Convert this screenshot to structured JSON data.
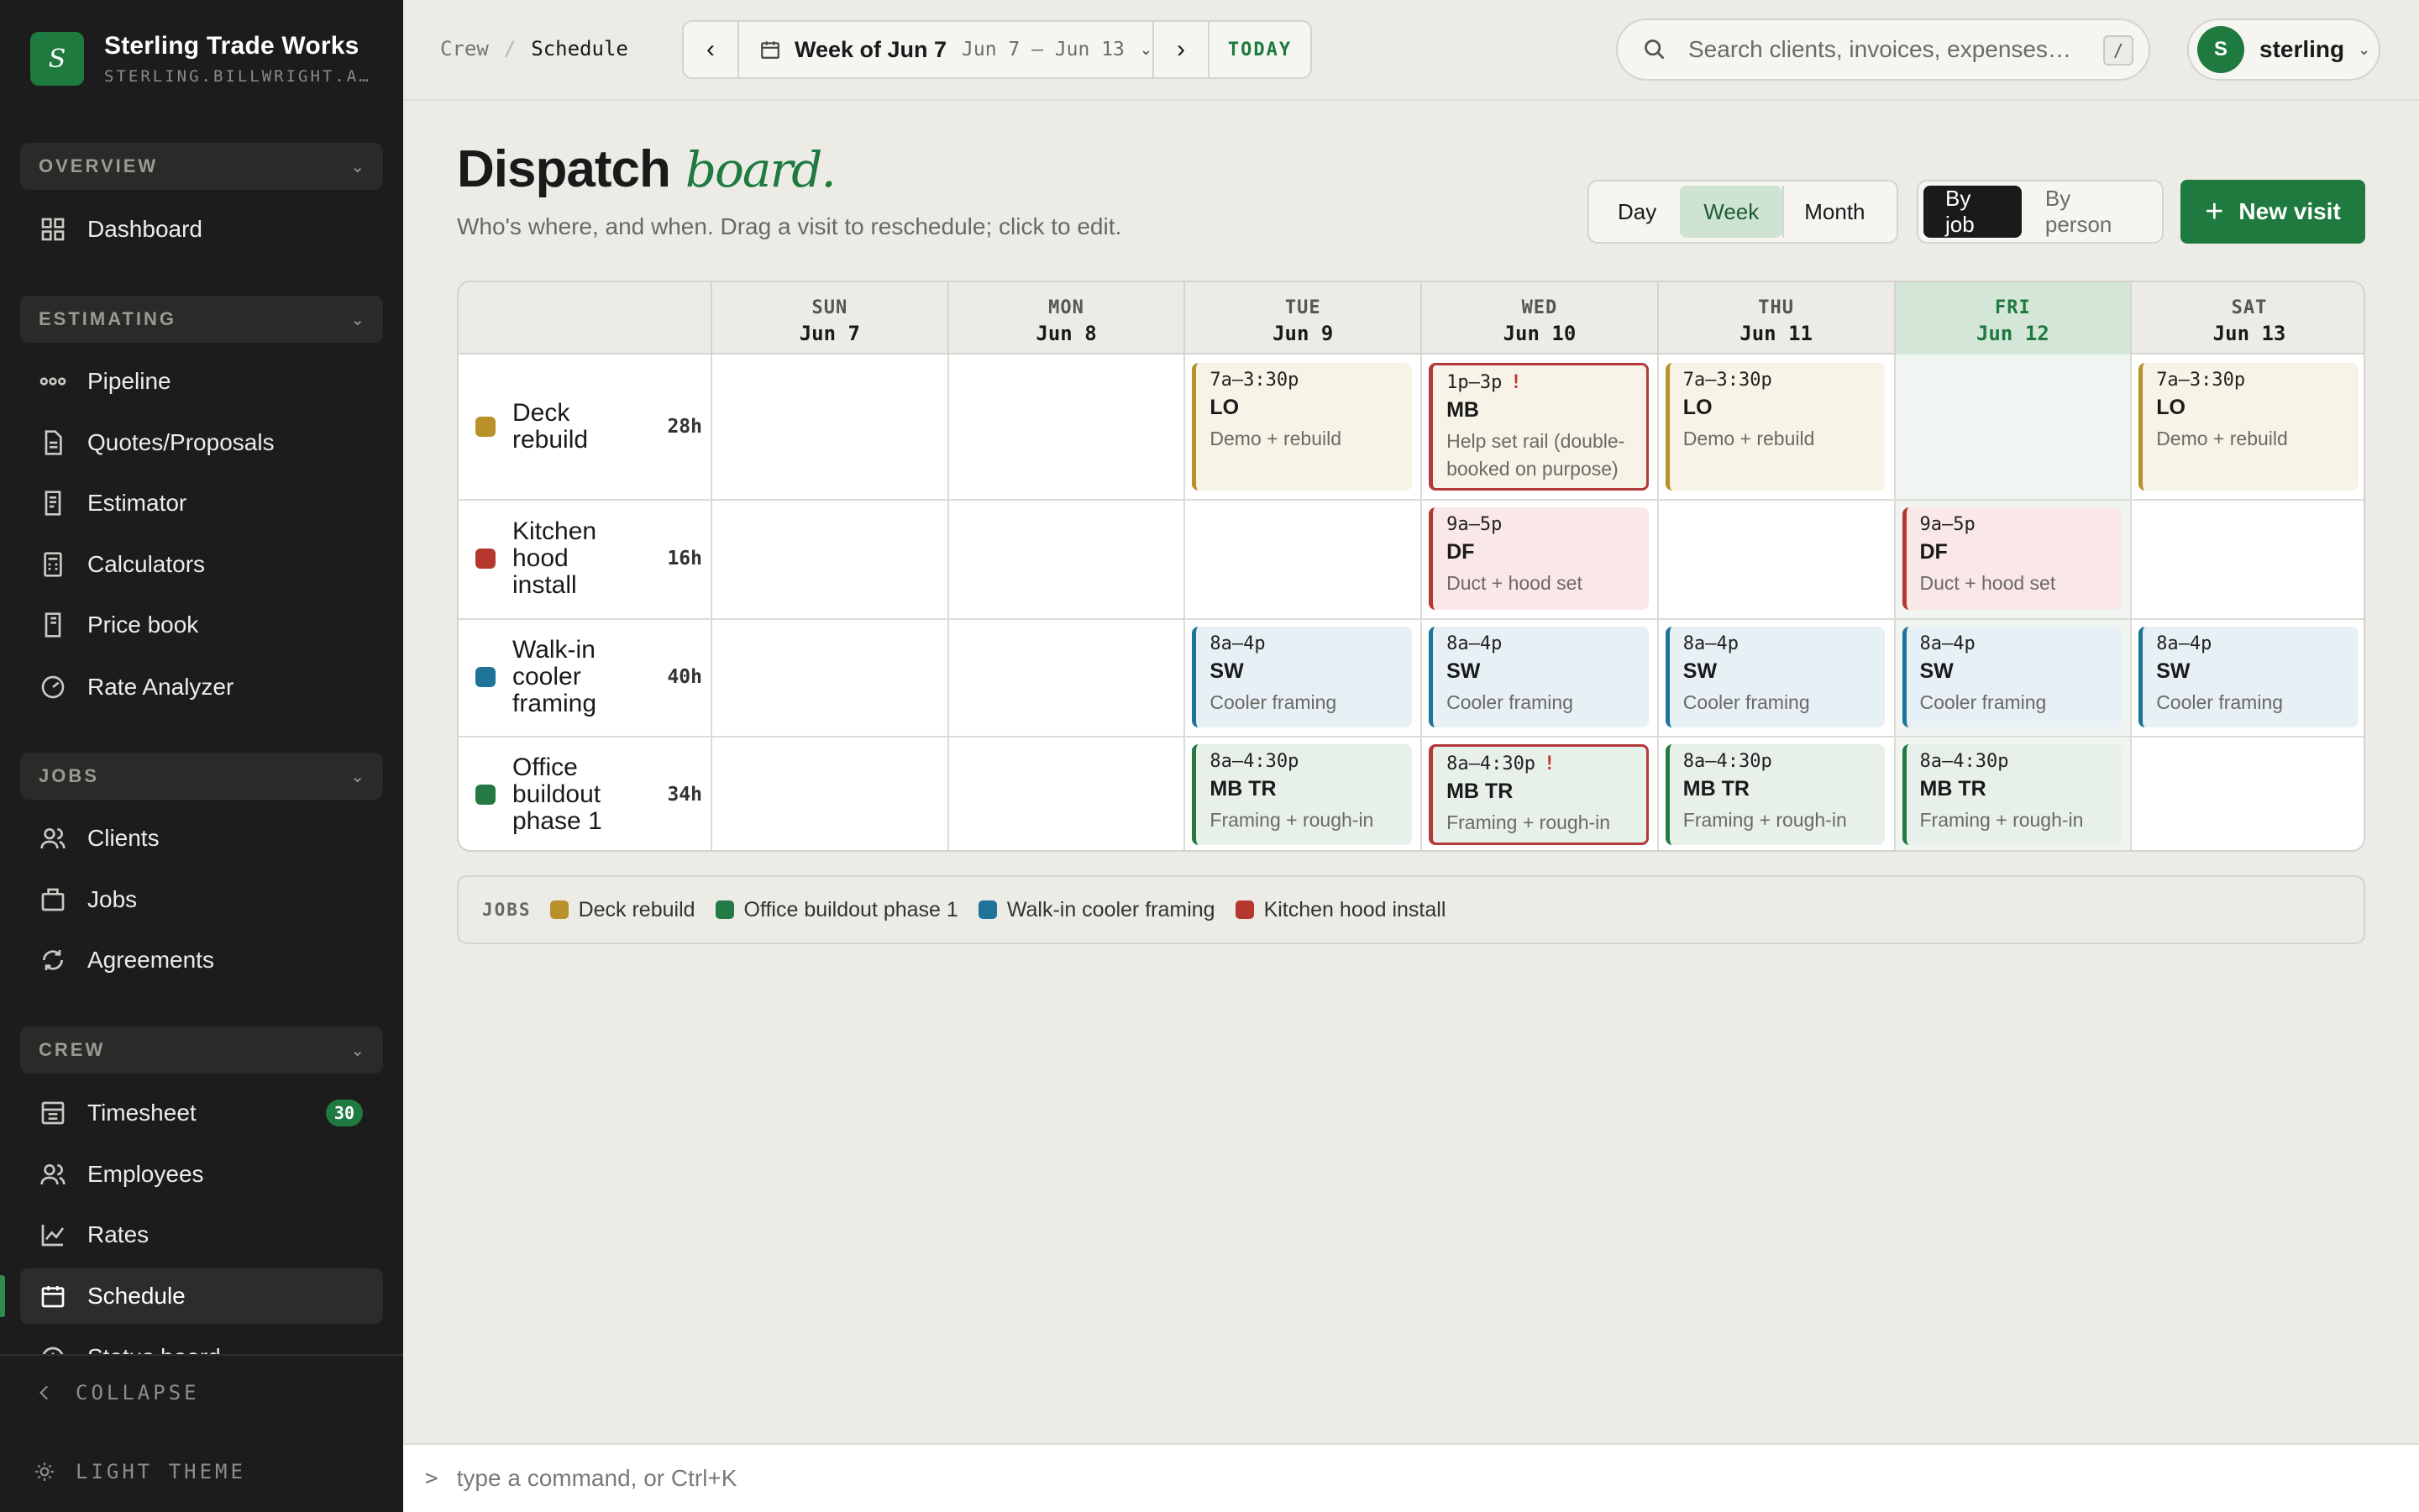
{
  "app": {
    "name": "Sterling Trade Works",
    "subdomain": "STERLING.BILLWRIGHT.A…",
    "logo_letter": "S"
  },
  "sidebar": {
    "groups": {
      "overview": "OVERVIEW",
      "estimating": "ESTIMATING",
      "jobs": "JOBS",
      "crew": "CREW"
    },
    "items": {
      "dashboard": "Dashboard",
      "pipeline": "Pipeline",
      "quotes": "Quotes/Proposals",
      "estimator": "Estimator",
      "calculators": "Calculators",
      "pricebook": "Price book",
      "rate_analyzer": "Rate Analyzer",
      "clients": "Clients",
      "jobs": "Jobs",
      "agreements": "Agreements",
      "timesheet": "Timesheet",
      "timesheet_badge": "30",
      "employees": "Employees",
      "rates": "Rates",
      "schedule": "Schedule",
      "status_board": "Status board"
    },
    "collapse": "COLLAPSE",
    "theme": "LIGHT THEME"
  },
  "topbar": {
    "breadcrumb": [
      "Crew",
      "Schedule"
    ],
    "week_label": "Week of Jun 7",
    "week_range": "Jun 7 – Jun 13",
    "today": "TODAY",
    "search_placeholder": "Search clients, invoices, expenses…",
    "search_kbd": "/",
    "user_initial": "S",
    "user_name": "sterling"
  },
  "page": {
    "title": "Dispatch",
    "title_accent": "board.",
    "subtitle": "Who's where, and when. Drag a visit to reschedule; click to edit.",
    "views": [
      "Day",
      "Week",
      "Month"
    ],
    "active_view": "Week",
    "groupings": [
      "By job",
      "By person"
    ],
    "active_grouping": "By job",
    "new_visit": "New visit"
  },
  "calendar": {
    "days": [
      {
        "dow": "SUN",
        "date": "Jun 7"
      },
      {
        "dow": "MON",
        "date": "Jun 8"
      },
      {
        "dow": "TUE",
        "date": "Jun 9"
      },
      {
        "dow": "WED",
        "date": "Jun 10"
      },
      {
        "dow": "THU",
        "date": "Jun 11"
      },
      {
        "dow": "FRI",
        "date": "Jun 12",
        "today": true
      },
      {
        "dow": "SAT",
        "date": "Jun 13"
      }
    ],
    "jobs": [
      {
        "name": "Deck rebuild",
        "hours": "28h",
        "color": "#b8912a"
      },
      {
        "name": "Kitchen hood install",
        "hours": "16h",
        "color": "#b5382f"
      },
      {
        "name": "Walk-in cooler framing",
        "hours": "40h",
        "color": "#1f7398"
      },
      {
        "name": "Office buildout phase 1",
        "hours": "34h",
        "color": "#247a44"
      }
    ],
    "visits": [
      {
        "job": 0,
        "day": 2,
        "time": "7a–3:30p",
        "crew": "LO",
        "desc": "Demo + rebuild"
      },
      {
        "job": 0,
        "day": 3,
        "time": "1p–3p",
        "crew": "MB",
        "desc": "Help set rail (double-booked on purpose)",
        "flag": "!"
      },
      {
        "job": 0,
        "day": 4,
        "time": "7a–3:30p",
        "crew": "LO",
        "desc": "Demo + rebuild"
      },
      {
        "job": 0,
        "day": 6,
        "time": "7a–3:30p",
        "crew": "LO",
        "desc": "Demo + rebuild"
      },
      {
        "job": 1,
        "day": 3,
        "time": "9a–5p",
        "crew": "DF",
        "desc": "Duct + hood set"
      },
      {
        "job": 1,
        "day": 5,
        "time": "9a–5p",
        "crew": "DF",
        "desc": "Duct + hood set"
      },
      {
        "job": 2,
        "day": 2,
        "time": "8a–4p",
        "crew": "SW",
        "desc": "Cooler framing"
      },
      {
        "job": 2,
        "day": 3,
        "time": "8a–4p",
        "crew": "SW",
        "desc": "Cooler framing"
      },
      {
        "job": 2,
        "day": 4,
        "time": "8a–4p",
        "crew": "SW",
        "desc": "Cooler framing"
      },
      {
        "job": 2,
        "day": 5,
        "time": "8a–4p",
        "crew": "SW",
        "desc": "Cooler framing"
      },
      {
        "job": 2,
        "day": 6,
        "time": "8a–4p",
        "crew": "SW",
        "desc": "Cooler framing"
      },
      {
        "job": 3,
        "day": 2,
        "time": "8a–4:30p",
        "crew": "MB TR",
        "desc": "Framing + rough-in"
      },
      {
        "job": 3,
        "day": 3,
        "time": "8a–4:30p",
        "crew": "MB TR",
        "desc": "Framing + rough-in",
        "flag": "!"
      },
      {
        "job": 3,
        "day": 4,
        "time": "8a–4:30p",
        "crew": "MB TR",
        "desc": "Framing + rough-in"
      },
      {
        "job": 3,
        "day": 5,
        "time": "8a–4:30p",
        "crew": "MB TR",
        "desc": "Framing + rough-in"
      }
    ],
    "tints": [
      "#f7f3e6",
      "#f9e8e7",
      "#e7f0f4",
      "#e7f1ea"
    ]
  },
  "legend": {
    "title": "JOBS",
    "items": [
      {
        "label": "Deck rebuild",
        "color": "#b8912a"
      },
      {
        "label": "Office buildout phase 1",
        "color": "#247a44"
      },
      {
        "label": "Walk-in cooler framing",
        "color": "#1f7398"
      },
      {
        "label": "Kitchen hood install",
        "color": "#b5382f"
      }
    ]
  },
  "command": {
    "prompt": ">",
    "placeholder": "type a command, or Ctrl+K"
  }
}
